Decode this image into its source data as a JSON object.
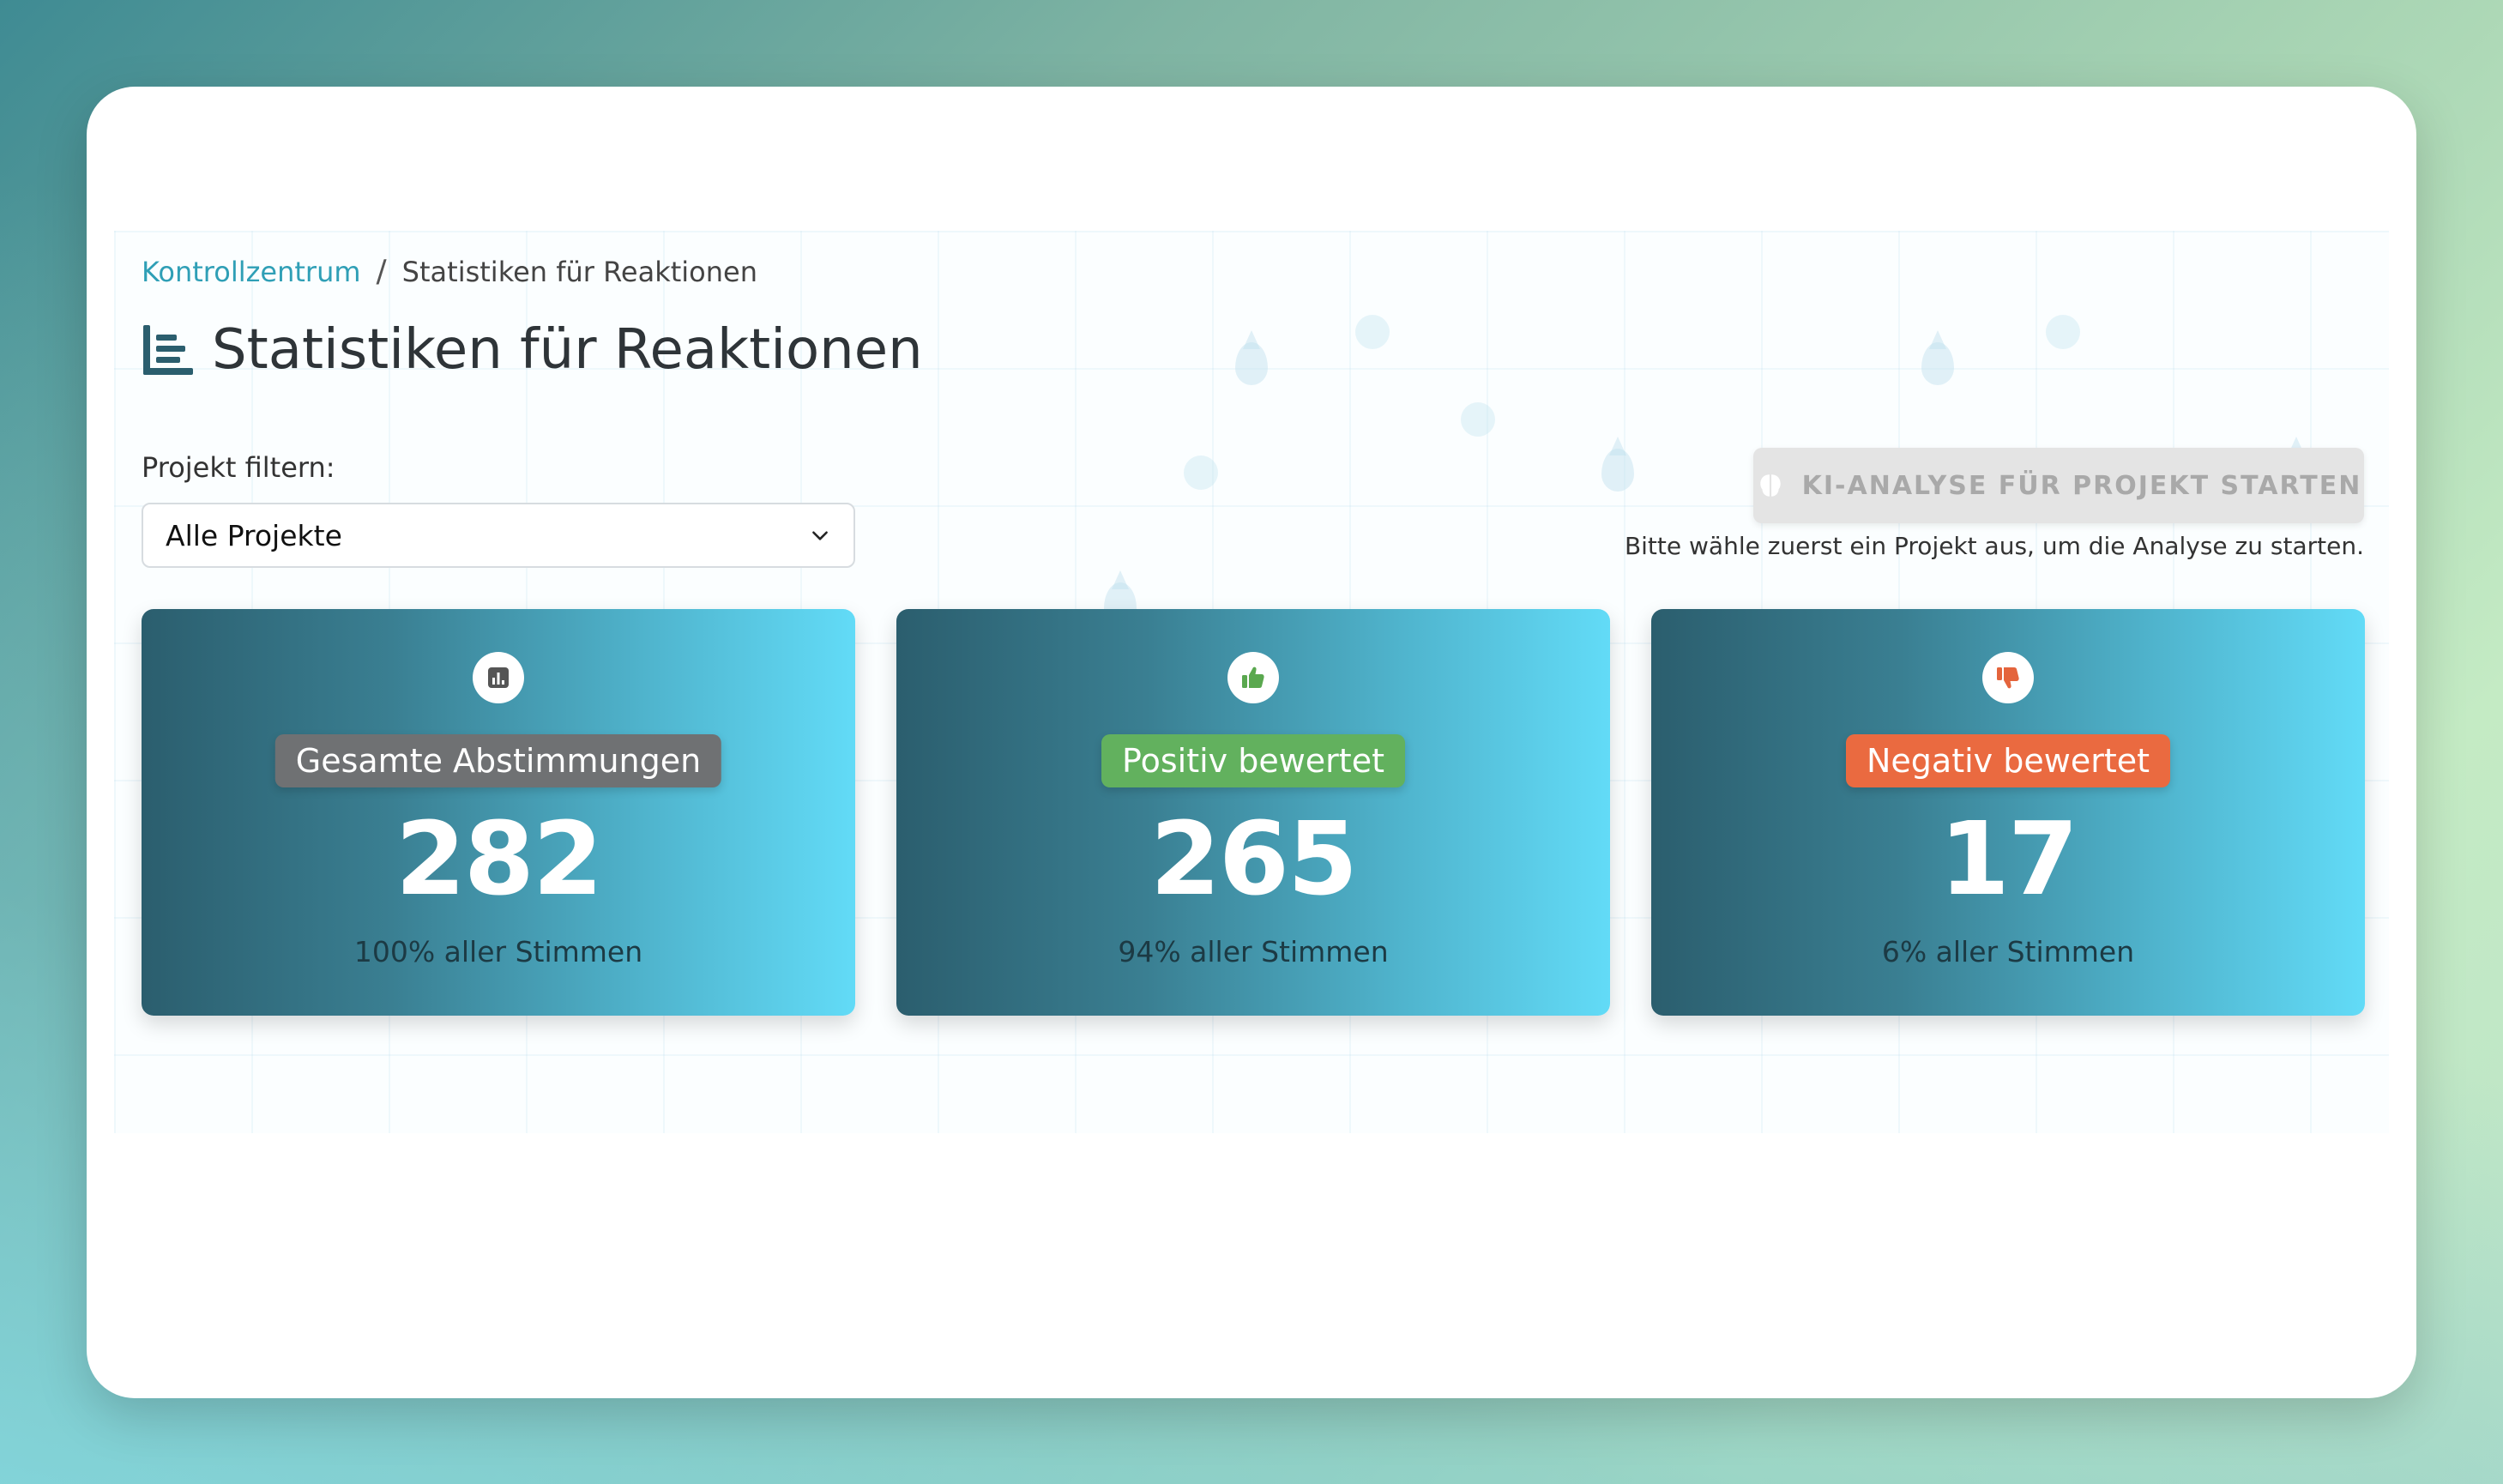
{
  "breadcrumb": {
    "root": "Kontrollzentrum",
    "separator": "/",
    "current": "Statistiken für Reaktionen"
  },
  "page": {
    "title": "Statistiken für Reaktionen",
    "title_icon": "bar-list-icon"
  },
  "filter": {
    "label": "Projekt filtern:",
    "selected": "Alle Projekte"
  },
  "ai": {
    "button_label": "KI-ANALYSE FÜR PROJEKT STARTEN",
    "icon": "brain-icon",
    "hint": "Bitte wähle zuerst ein Projekt aus, um die Analyse zu starten."
  },
  "cards": [
    {
      "icon": "chart-icon",
      "badge": "Gesamte Abstimmungen",
      "value": "282",
      "subtitle": "100% aller Stimmen",
      "badge_color": "#6f7173"
    },
    {
      "icon": "thumbs-up-icon",
      "badge": "Positiv bewertet",
      "value": "265",
      "subtitle": "94% aller Stimmen",
      "badge_color": "#62b15e"
    },
    {
      "icon": "thumbs-down-icon",
      "badge": "Negativ bewertet",
      "value": "17",
      "subtitle": "6% aller Stimmen",
      "badge_color": "#ea6a40"
    }
  ],
  "colors": {
    "accent": "#2f9fb6",
    "card_gradient_start": "#2b5e6e",
    "card_gradient_end": "#62dbf7"
  }
}
